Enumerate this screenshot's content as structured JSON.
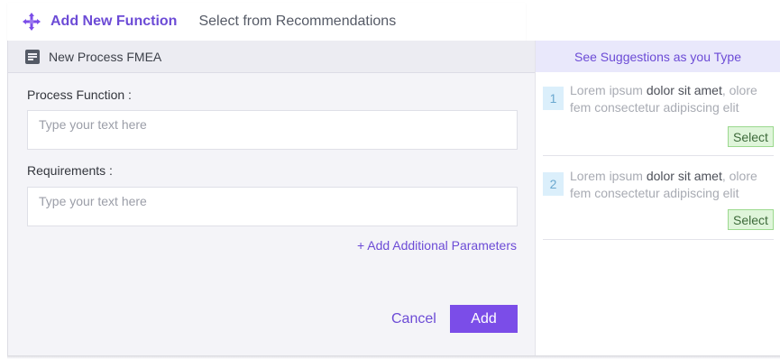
{
  "header": {
    "title": "Add New Function",
    "tab_recommendations": "Select from Recommendations"
  },
  "subbar": {
    "name": "New Process FMEA"
  },
  "form": {
    "process_function_label": "Process Function :",
    "process_function_placeholder": "Type your text here",
    "requirements_label": "Requirements :",
    "requirements_placeholder": "Type your text here",
    "add_params_label": "+ Add Additional Parameters",
    "cancel_label": "Cancel",
    "add_label": "Add"
  },
  "suggestions": {
    "heading": "See Suggestions as you Type",
    "items": [
      {
        "number": "1",
        "text_pre": "Lorem ipsum ",
        "text_bold": "dolor sit amet",
        "text_post": ", olore fem consectetur adipiscing elit",
        "select_label": "Select"
      },
      {
        "number": "2",
        "text_pre": "Lorem ipsum ",
        "text_bold": "dolor sit amet",
        "text_post": ", olore fem consectetur adipiscing elit",
        "select_label": "Select"
      }
    ]
  },
  "colors": {
    "accent": "#6c4bd6",
    "primary_button": "#7b4de8",
    "select_bg": "#dff5da",
    "number_bg": "#dbeffb"
  },
  "icons": {
    "logo": "move-arrows-icon",
    "doc": "document-icon"
  }
}
